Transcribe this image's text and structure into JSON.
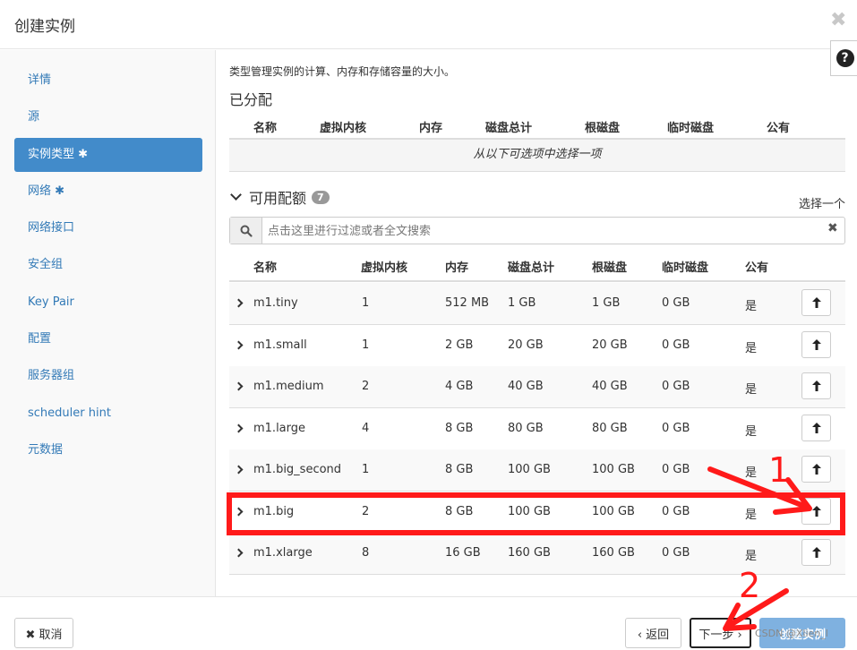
{
  "modal": {
    "title": "创建实例",
    "close_glyph": "✖",
    "help_glyph": "?"
  },
  "sidebar": {
    "items": [
      {
        "label": "详情",
        "active": false
      },
      {
        "label": "源",
        "active": false
      },
      {
        "label": "实例类型 ✱",
        "active": true
      },
      {
        "label": "网络 ✱",
        "active": false
      },
      {
        "label": "网络接口",
        "active": false
      },
      {
        "label": "安全组",
        "active": false
      },
      {
        "label": "Key Pair",
        "active": false
      },
      {
        "label": "配置",
        "active": false
      },
      {
        "label": "服务器组",
        "active": false
      },
      {
        "label": "scheduler hint",
        "active": false
      },
      {
        "label": "元数据",
        "active": false
      }
    ]
  },
  "content": {
    "intro": "类型管理实例的计算、内存和存储容量的大小。",
    "allocated_title": "已分配",
    "allocated_columns": [
      "名称",
      "虚拟内核",
      "内存",
      "磁盘总计",
      "根磁盘",
      "临时磁盘",
      "公有"
    ],
    "allocated_empty": "从以下可选项中选择一项",
    "available_title": "可用配额",
    "available_count": "7",
    "select_one": "选择一个",
    "search": {
      "placeholder": "点击这里进行过滤或者全文搜索",
      "value": "",
      "clear_glyph": "✖"
    },
    "available_columns": [
      "名称",
      "虚拟内核",
      "内存",
      "磁盘总计",
      "根磁盘",
      "临时磁盘",
      "公有"
    ],
    "flavors": [
      {
        "name": "m1.tiny",
        "vcpus": "1",
        "ram": "512 MB",
        "total_disk": "1 GB",
        "root_disk": "1 GB",
        "ephemeral": "0 GB",
        "public": "是"
      },
      {
        "name": "m1.small",
        "vcpus": "1",
        "ram": "2 GB",
        "total_disk": "20 GB",
        "root_disk": "20 GB",
        "ephemeral": "0 GB",
        "public": "是"
      },
      {
        "name": "m1.medium",
        "vcpus": "2",
        "ram": "4 GB",
        "total_disk": "40 GB",
        "root_disk": "40 GB",
        "ephemeral": "0 GB",
        "public": "是"
      },
      {
        "name": "m1.large",
        "vcpus": "4",
        "ram": "8 GB",
        "total_disk": "80 GB",
        "root_disk": "80 GB",
        "ephemeral": "0 GB",
        "public": "是"
      },
      {
        "name": "m1.big_second",
        "vcpus": "1",
        "ram": "8 GB",
        "total_disk": "100 GB",
        "root_disk": "100 GB",
        "ephemeral": "0 GB",
        "public": "是"
      },
      {
        "name": "m1.big",
        "vcpus": "2",
        "ram": "8 GB",
        "total_disk": "100 GB",
        "root_disk": "100 GB",
        "ephemeral": "0 GB",
        "public": "是"
      },
      {
        "name": "m1.xlarge",
        "vcpus": "8",
        "ram": "16 GB",
        "total_disk": "160 GB",
        "root_disk": "160 GB",
        "ephemeral": "0 GB",
        "public": "是"
      }
    ]
  },
  "footer": {
    "cancel": "✖ 取消",
    "back": "‹ 返回",
    "next": "下一步 ›",
    "create": "创建实例"
  },
  "annotations": {
    "step1": "1",
    "step2": "2",
    "highlight_color": "#ff1a1a"
  },
  "watermark": "CSDN @Xlien_l",
  "colors": {
    "primary": "#428bca",
    "link": "#337ab7",
    "annotation": "#ff1a1a"
  }
}
